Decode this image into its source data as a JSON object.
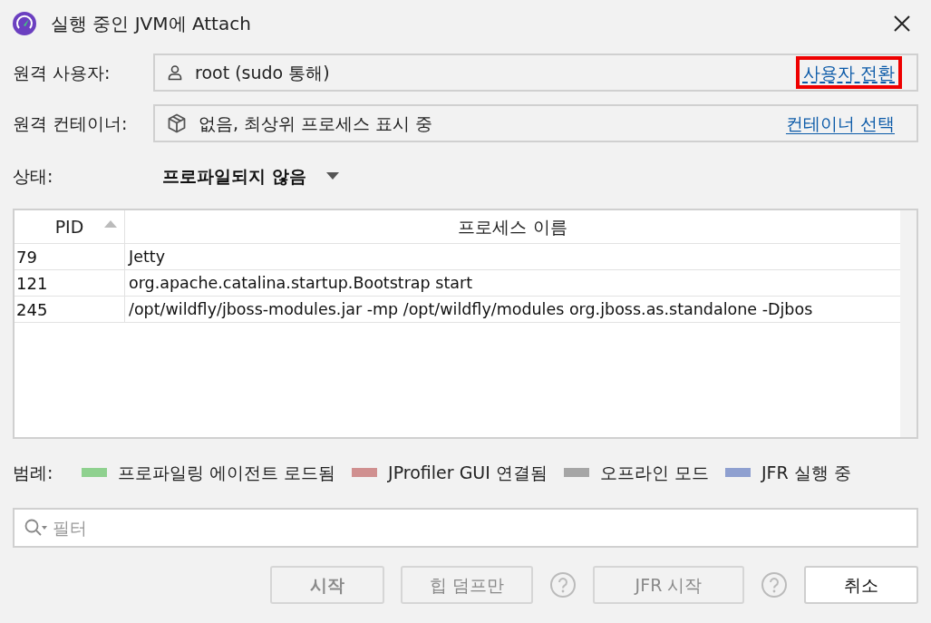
{
  "window": {
    "title": "실행 중인 JVM에 Attach"
  },
  "remote_user": {
    "label": "원격 사용자:",
    "value": "root (sudo 통해)",
    "link": {
      "label": "사용자 전환",
      "highlighted": true
    }
  },
  "remote_container": {
    "label": "원격 컨테이너:",
    "value": "없음, 최상위 프로세스 표시 중",
    "link": {
      "label": "컨테이너 선택",
      "highlighted": false
    }
  },
  "status": {
    "label": "상태:",
    "value": "프로파일되지 않음"
  },
  "table": {
    "columns": [
      {
        "label": "PID",
        "sorted": true
      },
      {
        "label": "프로세스 이름",
        "sorted": false
      }
    ],
    "rows": [
      {
        "pid": "79",
        "name": "Jetty"
      },
      {
        "pid": "121",
        "name": "org.apache.catalina.startup.Bootstrap start"
      },
      {
        "pid": "245",
        "name": "/opt/wildfly/jboss-modules.jar -mp /opt/wildfly/modules org.jboss.as.standalone -Djbos"
      }
    ]
  },
  "legend": {
    "label": "범례:",
    "items": [
      {
        "label": "프로파일링 에이전트 로드됨",
        "color": "#8fd18f"
      },
      {
        "label": "JProfiler GUI 연결됨",
        "color": "#d09090"
      },
      {
        "label": "오프라인 모드",
        "color": "#a6a6a6"
      },
      {
        "label": "JFR 실행 중",
        "color": "#8fa0d0"
      }
    ]
  },
  "filter": {
    "placeholder": "필터"
  },
  "buttons": [
    {
      "label": "시작",
      "kind": "button",
      "bold": true,
      "disabled": true
    },
    {
      "label": "힙 덤프만",
      "kind": "button",
      "bold": false,
      "disabled": true
    },
    {
      "kind": "help"
    },
    {
      "label": "JFR 시작",
      "kind": "button",
      "bold": false,
      "disabled": true
    },
    {
      "kind": "help"
    },
    {
      "label": "취소",
      "kind": "button",
      "bold": false,
      "disabled": false
    }
  ]
}
